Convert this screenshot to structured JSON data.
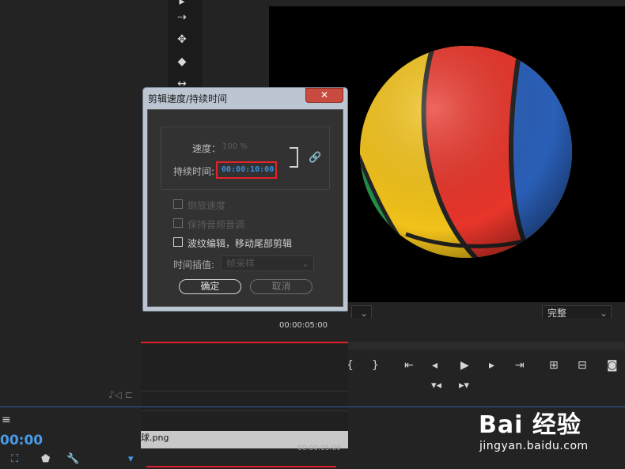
{
  "tools": {
    "icons": [
      "selection-tool-icon",
      "track-select-tool-icon",
      "ripple-edit-tool-icon",
      "razor-tool-icon",
      "slip-tool-icon"
    ]
  },
  "program_monitor": {
    "quality": "完整",
    "chevron": "⌄"
  },
  "timeline": {
    "ruler_time": "00:00:05:00",
    "current_time": "00:00",
    "clip_name": "球.png",
    "bottom_ruler_time": "00:00:05:00",
    "menu_glyph": "≡"
  },
  "dialog": {
    "title": "剪辑速度/持续时间",
    "close_glyph": "✕",
    "speed_label": "速度：",
    "speed_value": "100 %",
    "duration_label": "持续时间:",
    "duration_value": "00:00:10:00",
    "options": [
      {
        "label": "倒放速度",
        "checked": false,
        "enabled": false
      },
      {
        "label": "保持音频音调",
        "checked": false,
        "enabled": false
      },
      {
        "label": "波纹编辑，移动尾部剪辑",
        "checked": false,
        "enabled": true
      }
    ],
    "interp_label": "时间插值:",
    "interp_value": "帧采样",
    "ok_label": "确定",
    "cancel_label": "取消"
  },
  "watermark": {
    "logo": "Bai 经验",
    "url": "jingyan.baidu.com"
  },
  "colors": {
    "accent_blue": "#3a8fe0",
    "highlight_red": "#e3232a",
    "playhead_red": "#e0202a"
  }
}
